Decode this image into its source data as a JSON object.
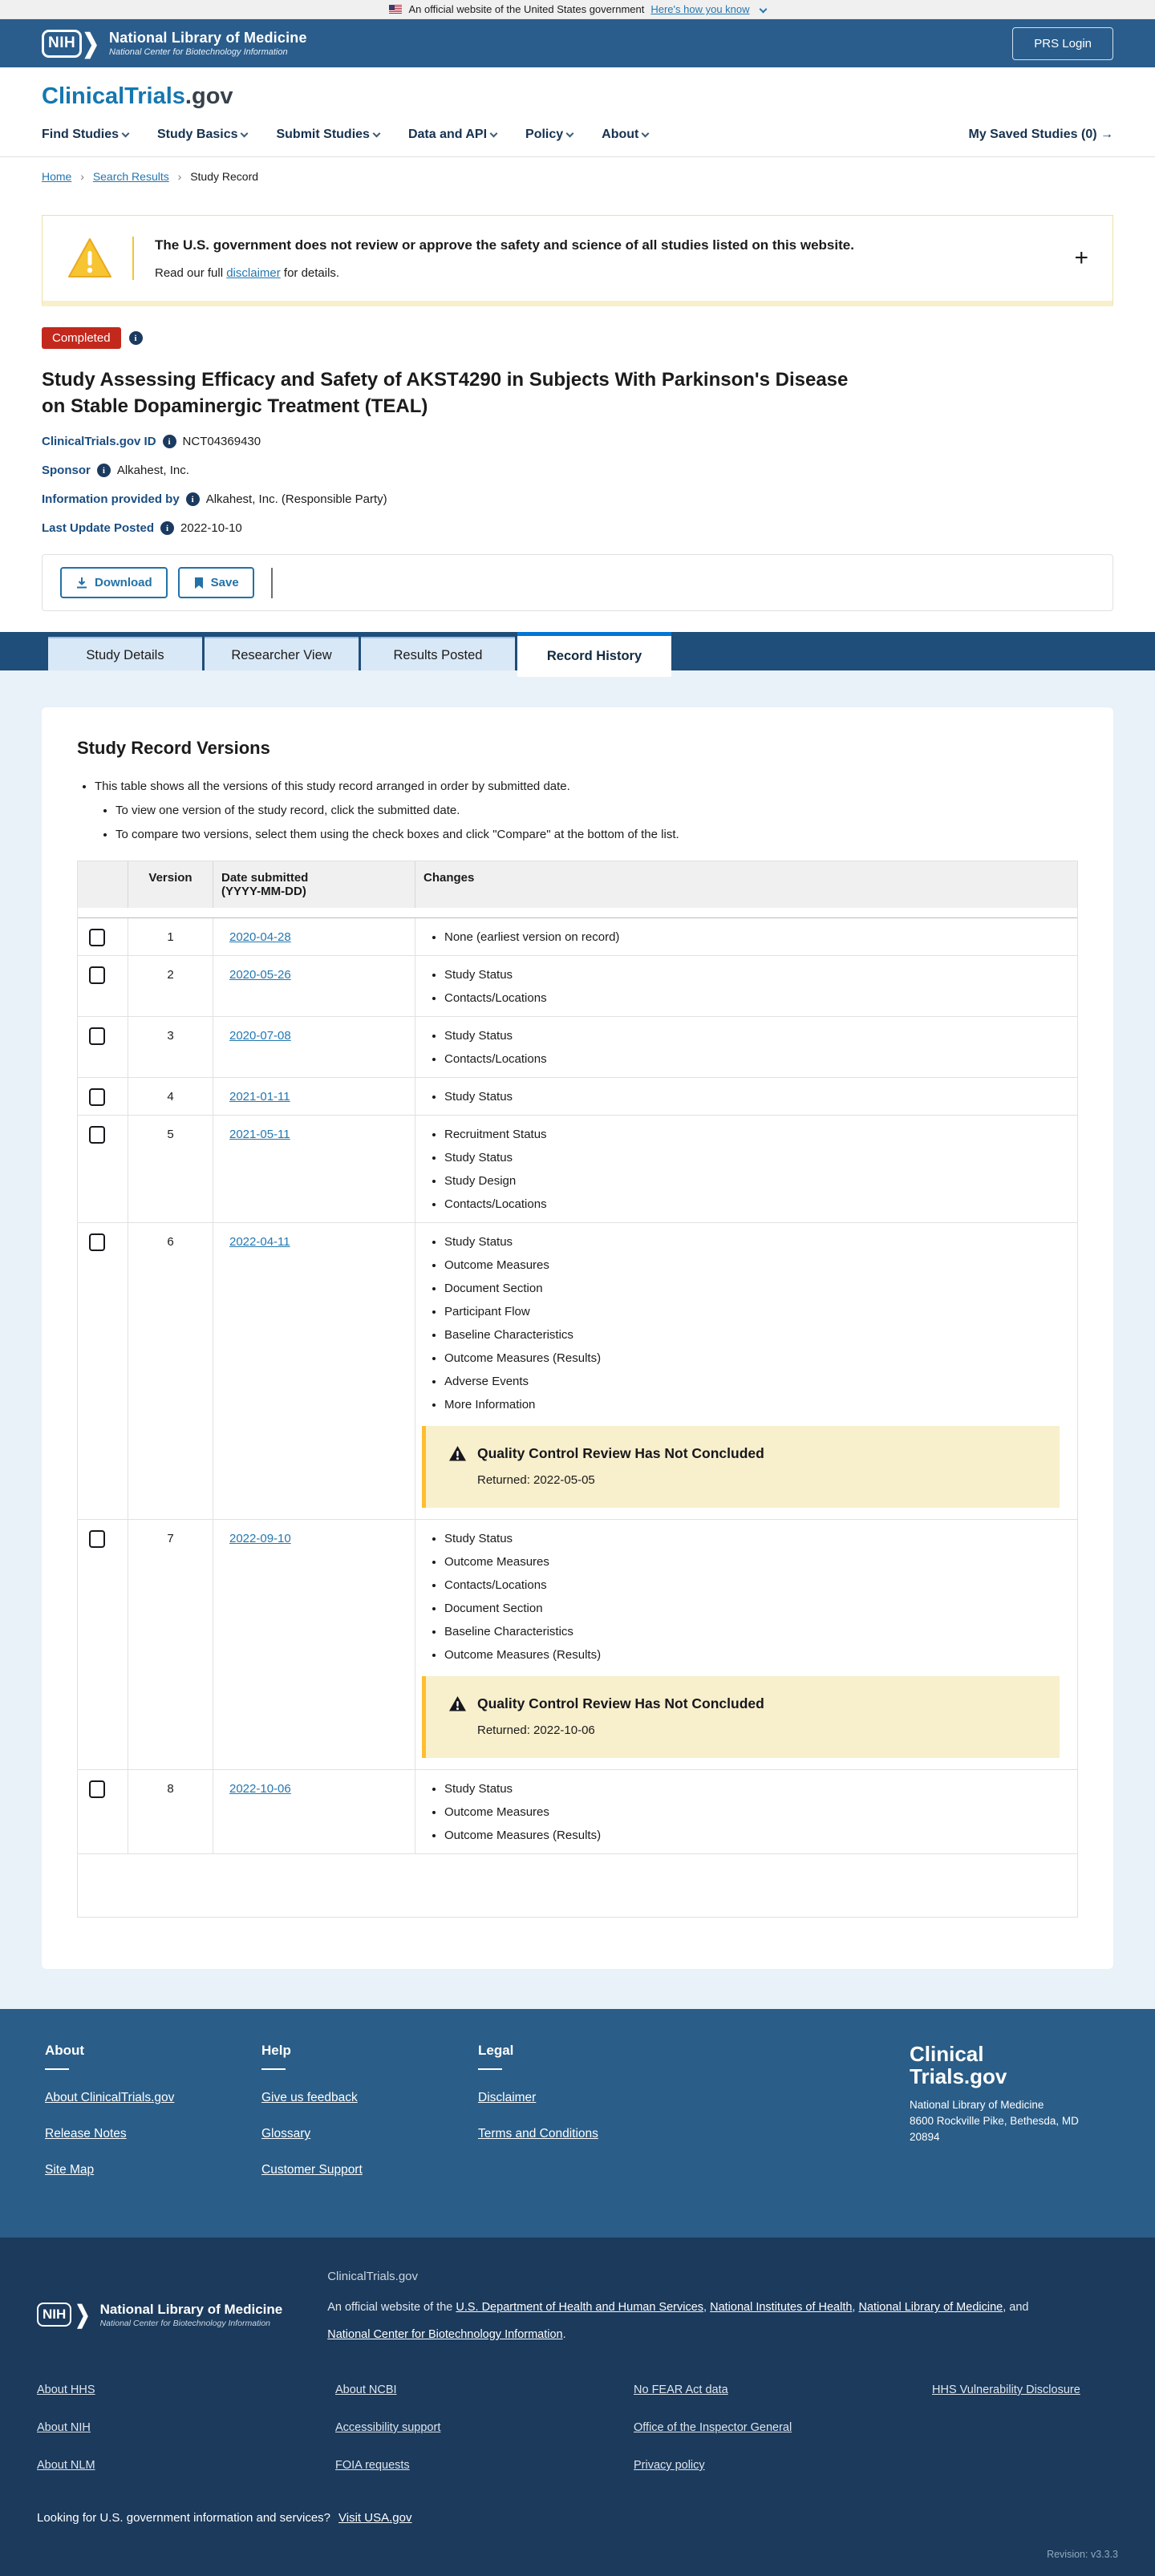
{
  "colors": {
    "header_blue": "#2a5d8c",
    "tab_band_blue": "#1e4e79",
    "light_blue_bg": "#e9f1f9",
    "status_red": "#c3281c",
    "link_blue": "#2477b0",
    "active_tab_bar": "#0076d6",
    "warning_bg": "#f8efcc",
    "warning_border": "#ffbe2e",
    "mid_footer": "#2a5d87",
    "dark_footer": "#1b3a5c"
  },
  "banner": {
    "text": "An official website of the United States government",
    "link": "Here's how you know"
  },
  "header": {
    "nih_logo": "NIH",
    "nlm_title": "National Library of Medicine",
    "nlm_subtitle": "National Center for Biotechnology Information",
    "prs_login": "PRS Login",
    "logo_primary": "ClinicalTrials",
    "logo_suffix": ".gov",
    "nav": [
      "Find Studies",
      "Study Basics",
      "Submit Studies",
      "Data and API",
      "Policy",
      "About"
    ],
    "saved_label": "My Saved Studies (0)",
    "saved_arrow": "→"
  },
  "breadcrumb": {
    "home": "Home",
    "search": "Search Results",
    "current": "Study Record"
  },
  "disclaimer": {
    "title": "The U.S. government does not review or approve the safety and science of all studies listed on this website.",
    "body_prefix": "Read our full ",
    "link": "disclaimer",
    "body_suffix": " for details.",
    "expand": "+"
  },
  "study": {
    "status": "Completed",
    "title": "Study Assessing Efficacy and Safety of AKST4290 in Subjects With Parkinson's Disease on Stable Dopaminergic Treatment (TEAL)",
    "id_label": "ClinicalTrials.gov ID",
    "id_value": "NCT04369430",
    "sponsor_label": "Sponsor",
    "sponsor_value": "Alkahest, Inc.",
    "info_label": "Information provided by",
    "info_value": "Alkahest, Inc. (Responsible Party)",
    "updated_label": "Last Update Posted",
    "updated_value": "2022-10-10",
    "download_label": "Download",
    "save_label": "Save"
  },
  "tabs": {
    "study_details": "Study Details",
    "researcher_view": "Researcher View",
    "results_posted": "Results Posted",
    "record_history": "Record History"
  },
  "record_history": {
    "heading": "Study Record Versions",
    "intro": "This table shows all the versions of this study record arranged in order by submitted date.",
    "sub_bullet_1": "To view one version of the study record, click the submitted date.",
    "sub_bullet_2": "To compare two versions, select them using the check boxes and click \"Compare\" at the bottom of the list.",
    "table": {
      "col_version": "Version",
      "col_date_line1": "Date submitted",
      "col_date_line2": "(YYYY-MM-DD)",
      "col_changes": "Changes",
      "rows": [
        {
          "version": "1",
          "date": "2020-04-28",
          "changes": [
            "None (earliest version on record)"
          ]
        },
        {
          "version": "2",
          "date": "2020-05-26",
          "changes": [
            "Study Status",
            "Contacts/Locations"
          ]
        },
        {
          "version": "3",
          "date": "2020-07-08",
          "changes": [
            "Study Status",
            "Contacts/Locations"
          ]
        },
        {
          "version": "4",
          "date": "2021-01-11",
          "changes": [
            "Study Status"
          ]
        },
        {
          "version": "5",
          "date": "2021-05-11",
          "changes": [
            "Recruitment Status",
            "Study Status",
            "Study Design",
            "Contacts/Locations"
          ]
        },
        {
          "version": "6",
          "date": "2022-04-11",
          "changes": [
            "Study Status",
            "Outcome Measures",
            "Document Section",
            "Participant Flow",
            "Baseline Characteristics",
            "Outcome Measures (Results)",
            "Adverse Events",
            "More Information"
          ],
          "warning": {
            "title": "Quality Control Review Has Not Concluded",
            "returned": "Returned: 2022-05-05"
          }
        },
        {
          "version": "7",
          "date": "2022-09-10",
          "changes": [
            "Study Status",
            "Outcome Measures",
            "Contacts/Locations",
            "Document Section",
            "Baseline Characteristics",
            "Outcome Measures (Results)"
          ],
          "warning": {
            "title": "Quality Control Review Has Not Concluded",
            "returned": "Returned: 2022-10-06"
          }
        },
        {
          "version": "8",
          "date": "2022-10-06",
          "changes": [
            "Study Status",
            "Outcome Measures",
            "Outcome Measures (Results)"
          ]
        }
      ]
    }
  },
  "footer_mid": {
    "columns": [
      {
        "title": "About",
        "links": [
          "About ClinicalTrials.gov",
          "Release Notes",
          "Site Map"
        ]
      },
      {
        "title": "Help",
        "links": [
          "Give us feedback",
          "Glossary",
          "Customer Support"
        ]
      },
      {
        "title": "Legal",
        "links": [
          "Disclaimer",
          "Terms and Conditions"
        ]
      }
    ],
    "logo_line1": "Clinical",
    "logo_line2": "Trials.gov",
    "address_line1": "National Library of Medicine",
    "address_line2": "8600 Rockville Pike, Bethesda, MD",
    "address_line3": "20894"
  },
  "footer_dark": {
    "nih_logo": "NIH",
    "nlm_title": "National Library of Medicine",
    "nlm_subtitle": "National Center for Biotechnology Information",
    "ct_label": "ClinicalTrials.gov",
    "official_parts": [
      {
        "text": "An official website of the "
      },
      {
        "link": "U.S. Department of Health and Human Services"
      },
      {
        "text": ", "
      },
      {
        "link": "National Institutes of Health"
      },
      {
        "text": ", "
      },
      {
        "link": "National Library of Medicine"
      },
      {
        "text": ", and "
      },
      {
        "link": "National Center for Biotechnology Information"
      },
      {
        "text": "."
      }
    ],
    "link_columns": [
      [
        "About HHS",
        "About NIH",
        "About NLM"
      ],
      [
        "About NCBI",
        "Accessibility support",
        "FOIA requests"
      ],
      [
        "No FEAR Act data",
        "Office of the Inspector General",
        "Privacy policy"
      ],
      [
        "HHS Vulnerability Disclosure"
      ]
    ],
    "usa_text": "Looking for U.S. government information and services?",
    "usa_link": "Visit USA.gov",
    "revision": "Revision: v3.3.3"
  }
}
